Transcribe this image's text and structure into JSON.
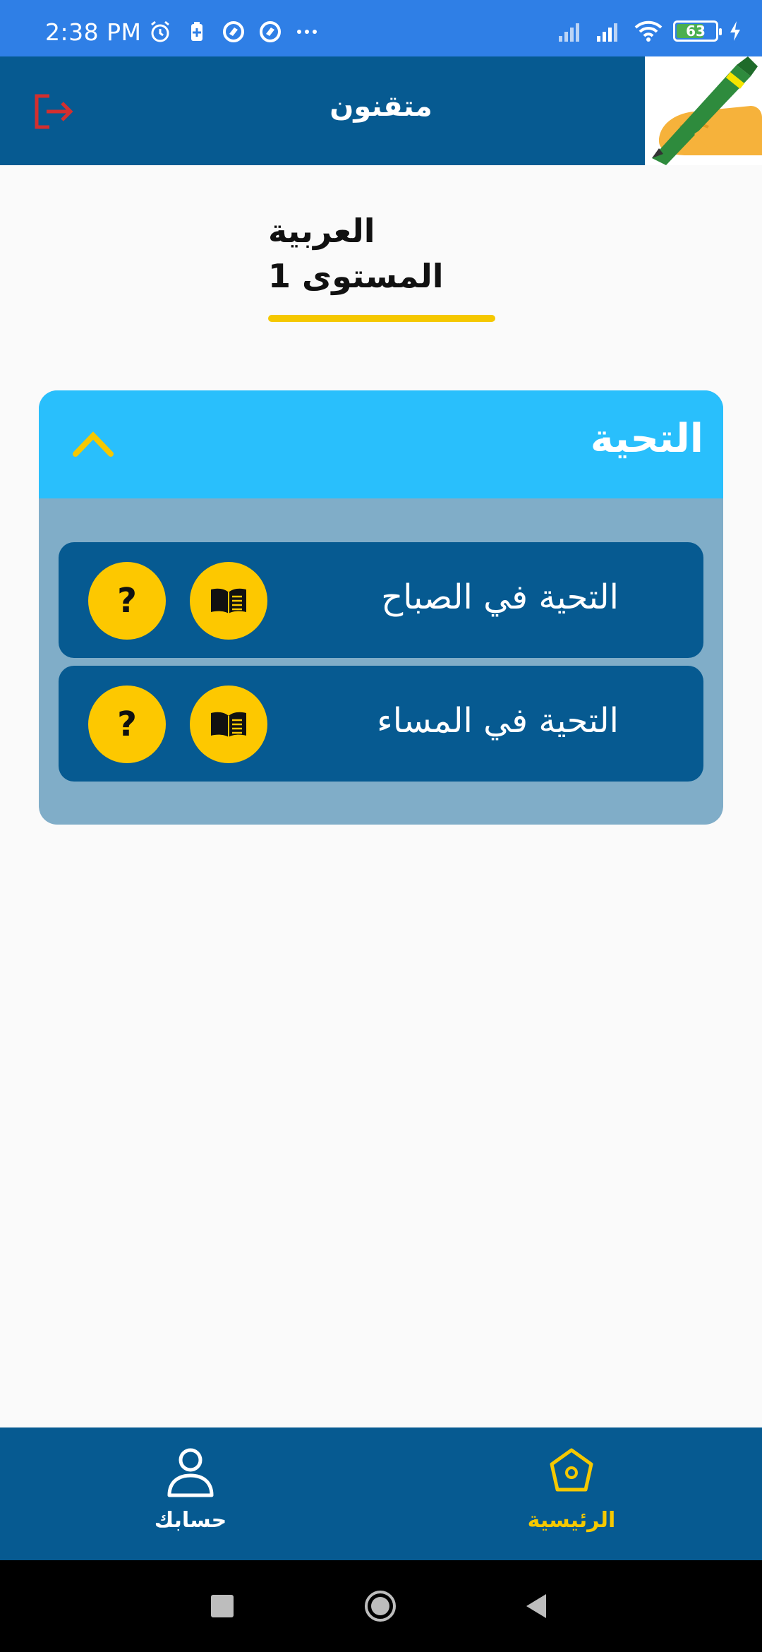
{
  "status_bar": {
    "time": "2:38 PM",
    "battery_level": "63",
    "icons": [
      "alarm-icon",
      "battery-saver-icon",
      "vpn-icon",
      "sync-icon",
      "more-dots-icon",
      "signal-icon",
      "signal-icon",
      "wifi-icon",
      "battery-icon",
      "charging-icon"
    ]
  },
  "app_bar": {
    "title": "متقنون",
    "logout_icon": "logout-icon",
    "logo_icon": "pen-hand-logo"
  },
  "course": {
    "name": "العربية",
    "level": "المستوى 1"
  },
  "section": {
    "title": "التحية",
    "expanded_icon": "chevron-up-icon",
    "lessons": [
      {
        "title": "التحية في الصباح",
        "read_icon": "book-icon",
        "quiz_label": "?"
      },
      {
        "title": "التحية في المساء",
        "read_icon": "book-icon",
        "quiz_label": "?"
      }
    ]
  },
  "bottom_nav": {
    "items": [
      {
        "label": "الرئيسية",
        "icon": "home-icon",
        "active": true
      },
      {
        "label": "حسابك",
        "icon": "person-icon",
        "active": false
      }
    ]
  },
  "colors": {
    "status_bar": "#2f7fe6",
    "primary": "#065a91",
    "accent": "#f5c800",
    "section_header": "#29bffc",
    "section_body": "#80adc8",
    "logout": "#d32f2f"
  }
}
